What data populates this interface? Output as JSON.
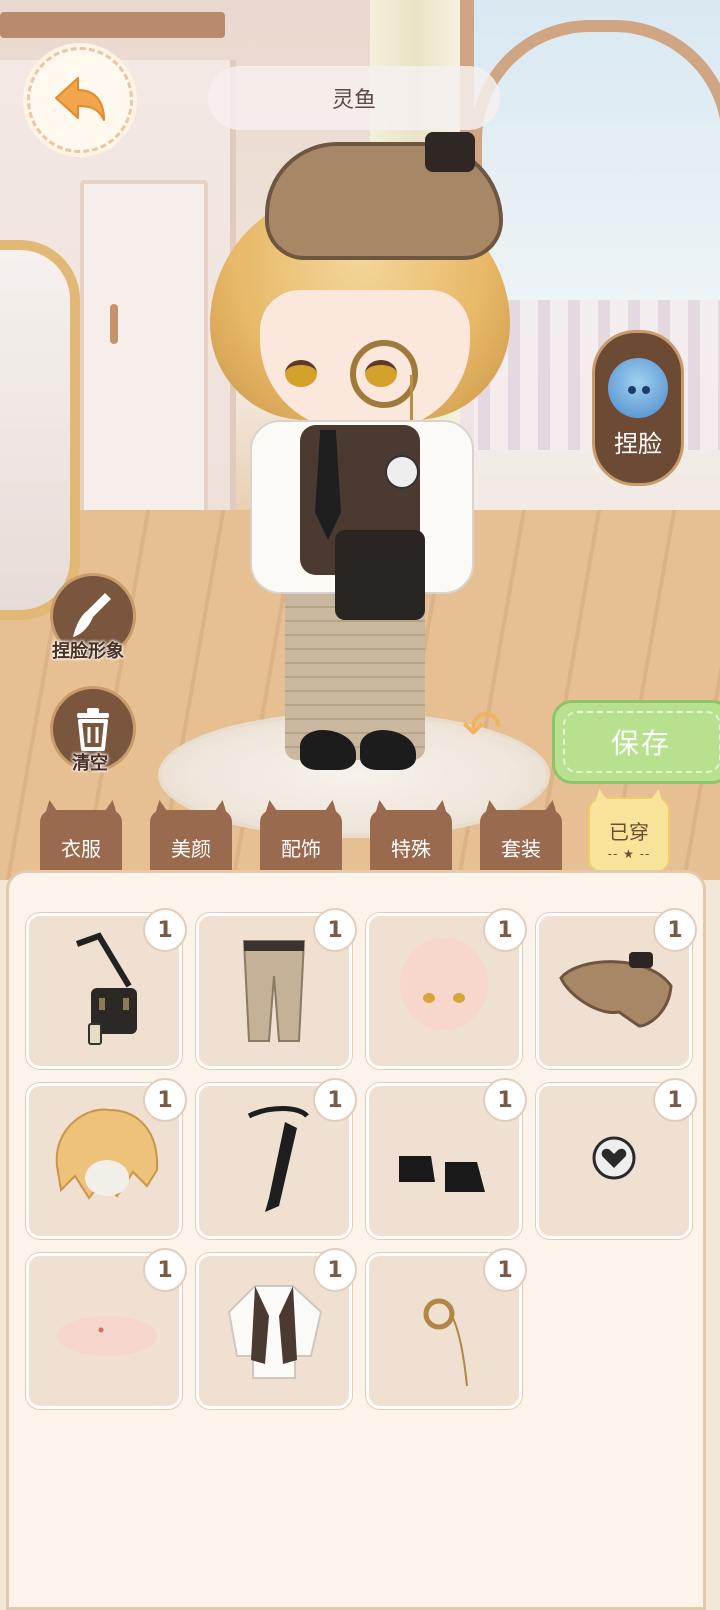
{
  "header": {
    "title": "灵鱼"
  },
  "side_buttons": {
    "face_edit": "捏脸",
    "face_image": "捏脸形象",
    "clear": "清空"
  },
  "actions": {
    "save": "保存"
  },
  "tabs": [
    {
      "label": "衣服",
      "active": false
    },
    {
      "label": "美颜",
      "active": false
    },
    {
      "label": "配饰",
      "active": false
    },
    {
      "label": "特殊",
      "active": false
    },
    {
      "label": "套装",
      "active": false
    },
    {
      "label": "已穿",
      "active": true
    }
  ],
  "items": [
    {
      "icon": "crossbody-bag-icon",
      "count": "1"
    },
    {
      "icon": "plaid-pants-icon",
      "count": "1"
    },
    {
      "icon": "head-base-icon",
      "count": "1"
    },
    {
      "icon": "flat-cap-icon",
      "count": "1"
    },
    {
      "icon": "blonde-hair-icon",
      "count": "1"
    },
    {
      "icon": "black-tie-icon",
      "count": "1"
    },
    {
      "icon": "black-shoes-icon",
      "count": "1"
    },
    {
      "icon": "heart-badge-icon",
      "count": "1"
    },
    {
      "icon": "skin-blush-icon",
      "count": "1"
    },
    {
      "icon": "shirt-vest-icon",
      "count": "1"
    },
    {
      "icon": "monocle-icon",
      "count": "1"
    }
  ],
  "colors": {
    "accent": "#9a6a4e",
    "save": "#b7e18e",
    "active_tab": "#f8e39a"
  }
}
